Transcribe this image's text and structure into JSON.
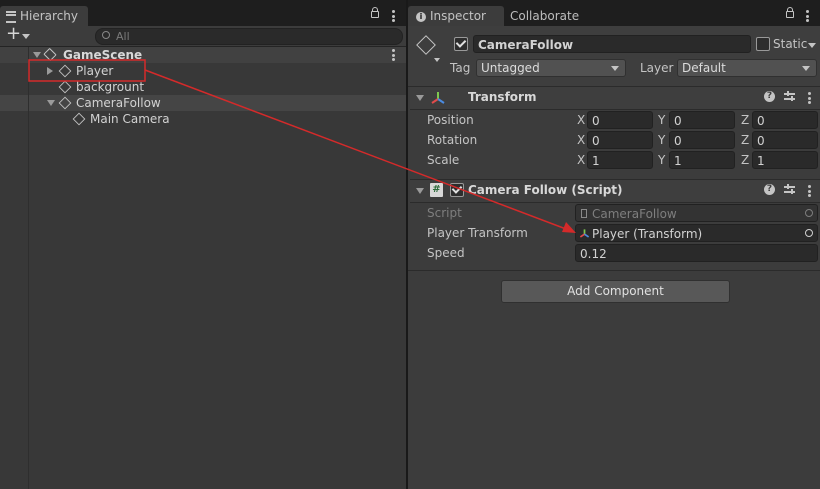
{
  "hierarchy": {
    "tab_label": "Hierarchy",
    "search_placeholder": "All",
    "add_label": "+",
    "scene_name": "GameScene",
    "items": [
      {
        "label": "Player"
      },
      {
        "label": "backgrount"
      },
      {
        "label": "CameraFollow"
      },
      {
        "label": "Main Camera"
      }
    ]
  },
  "inspector": {
    "tabs": [
      "Inspector",
      "Collaborate"
    ],
    "object_name": "CameraFollow",
    "static_label": "Static",
    "tag_label": "Tag",
    "tag_value": "Untagged",
    "layer_label": "Layer",
    "layer_value": "Default",
    "transform": {
      "title": "Transform",
      "rows": [
        {
          "label": "Position",
          "x": "0",
          "y": "0",
          "z": "0"
        },
        {
          "label": "Rotation",
          "x": "0",
          "y": "0",
          "z": "0"
        },
        {
          "label": "Scale",
          "x": "1",
          "y": "1",
          "z": "1"
        }
      ],
      "axis_x": "X",
      "axis_y": "Y",
      "axis_z": "Z"
    },
    "script_component": {
      "title": "Camera Follow (Script)",
      "script_label": "Script",
      "script_value": "CameraFollow",
      "player_transform_label": "Player Transform",
      "player_transform_value": "Player (Transform)",
      "speed_label": "Speed",
      "speed_value": "0.12"
    },
    "add_component_label": "Add Component"
  },
  "colors": {
    "annotation_red": "#d42a2a",
    "selection_blue": "#2c5d87"
  }
}
